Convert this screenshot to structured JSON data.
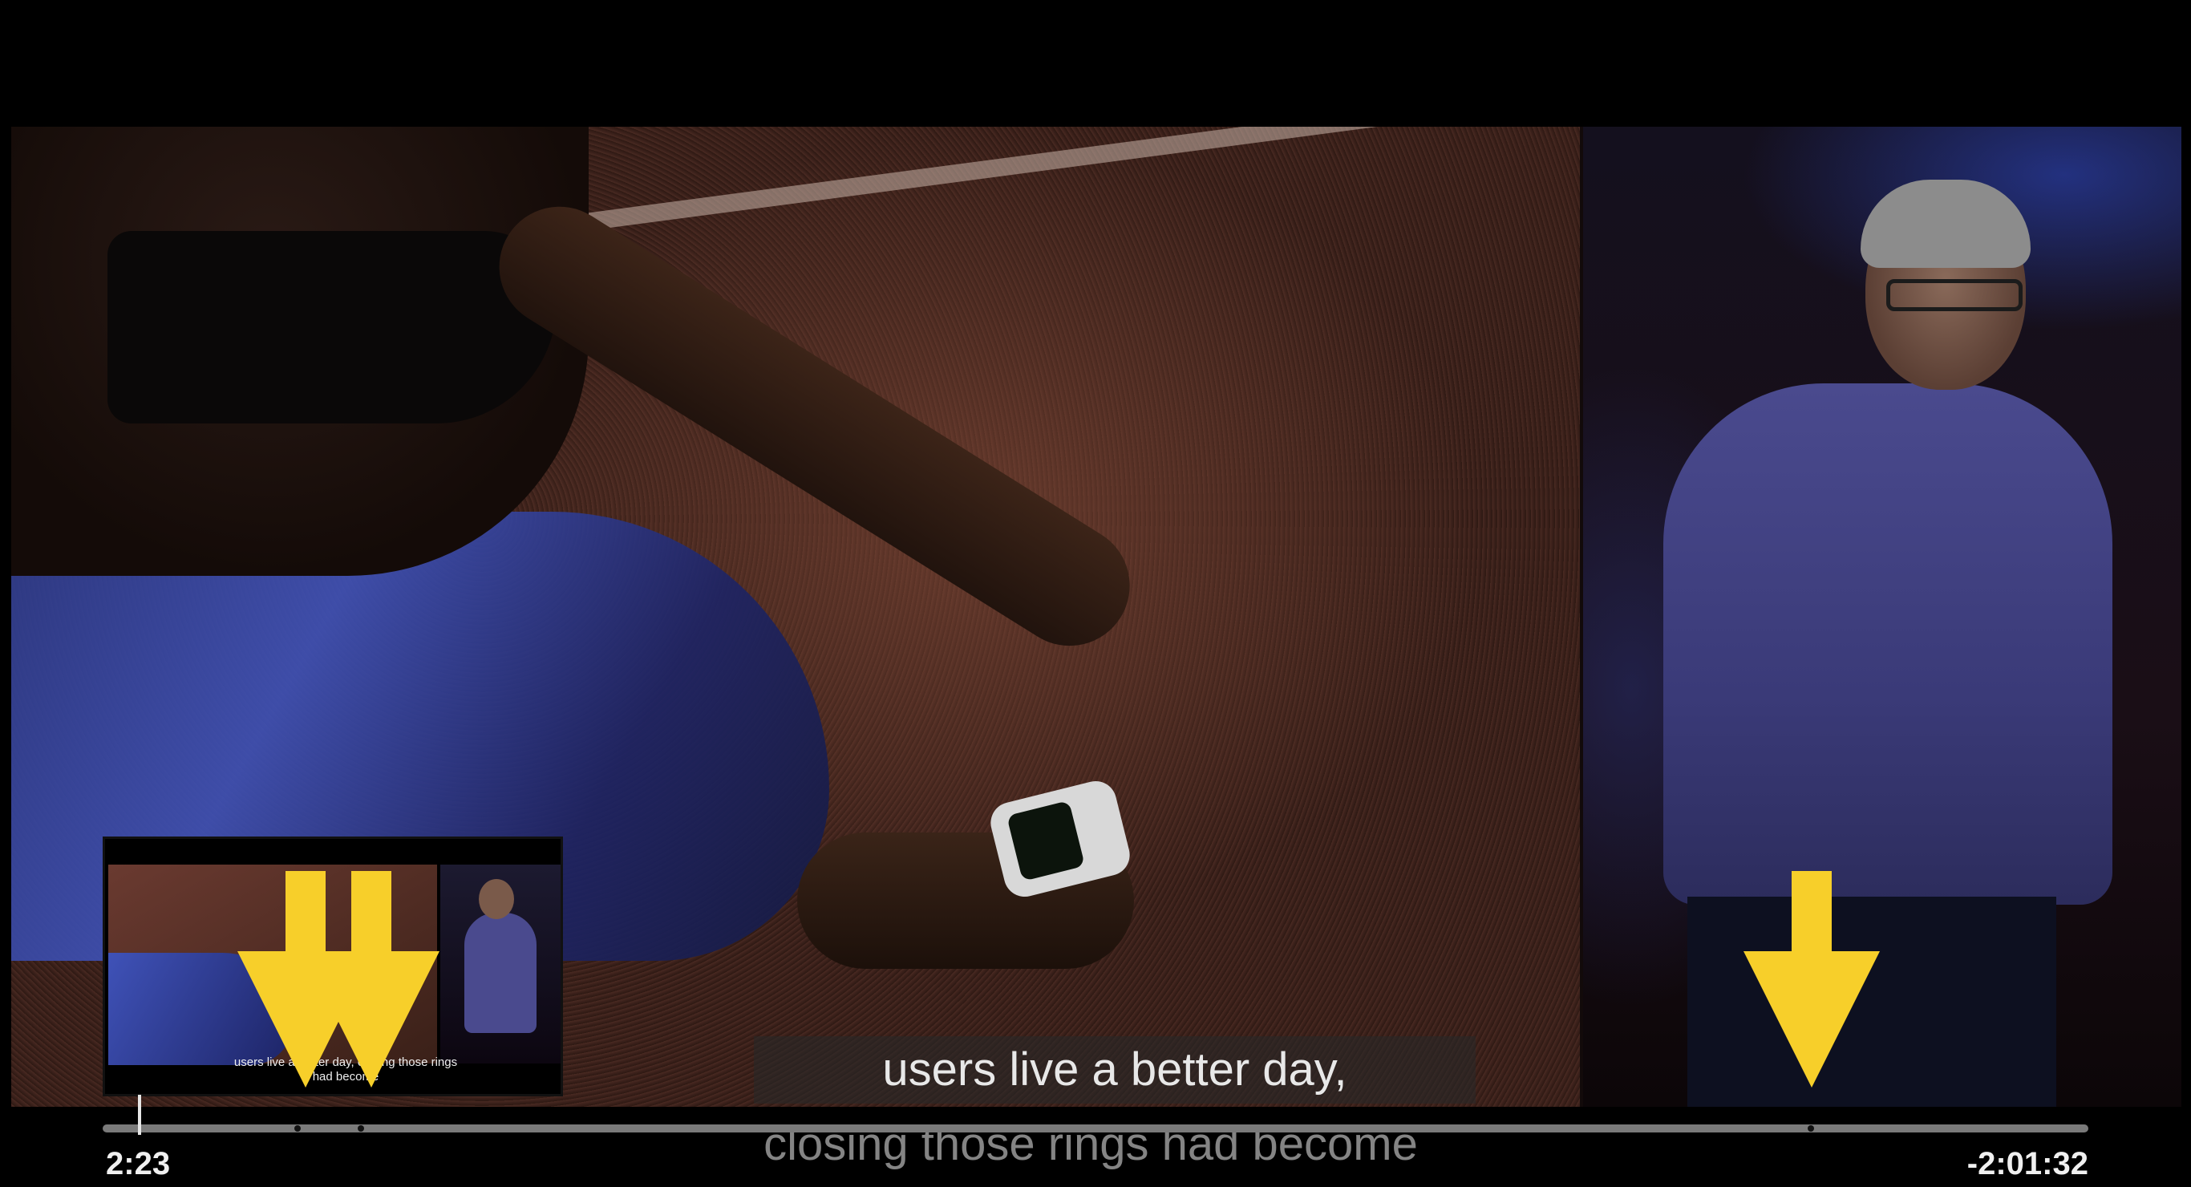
{
  "player": {
    "caption_line1": "users live a better day,",
    "caption_line2": "closing those rings had become",
    "elapsed_time": "2:23",
    "remaining_time": "-2:01:32",
    "progress_fraction": 0.02
  },
  "thumbnail": {
    "caption": "users live a better day, closing those rings had become"
  },
  "colors": {
    "arrow": "#f7cf2a",
    "scrubber_track": "#7a7a7a",
    "scrubber_head": "#e6e6e6"
  },
  "icons": {
    "annotation": "down-arrow-icon"
  }
}
